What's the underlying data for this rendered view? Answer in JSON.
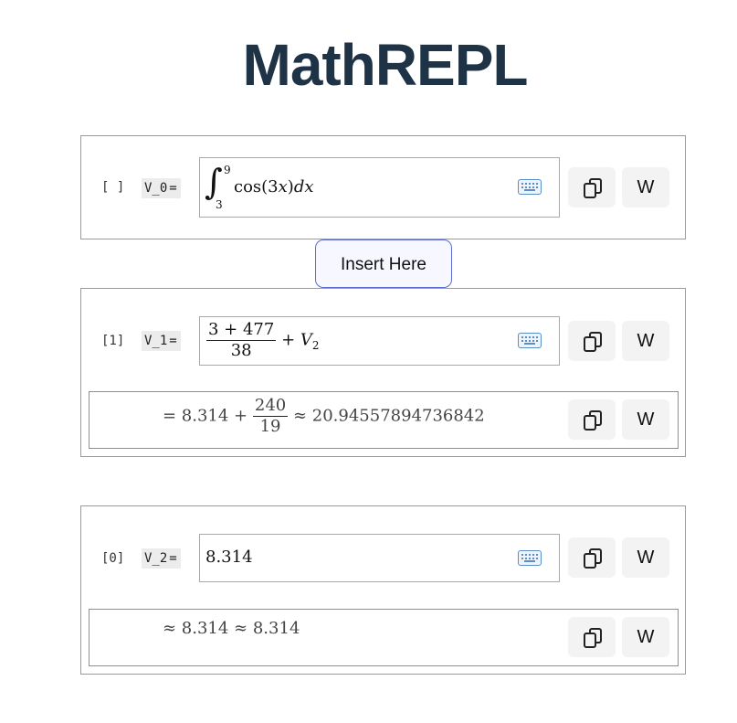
{
  "app": {
    "title": "MathREPL"
  },
  "insert_button": "Insert Here",
  "cells": [
    {
      "exec": "[ ]",
      "var": "V_0",
      "eq": "=",
      "input": {
        "upper": "9",
        "lower": "3",
        "integrand": "cos(3",
        "var_x": "x",
        "close": ")",
        "d": "d",
        "var_x2": "x"
      },
      "copy": "copy",
      "wolfram": "W"
    },
    {
      "exec": "[1]",
      "var": "V_1",
      "eq": "=",
      "input": {
        "num": "3 + 477",
        "den": "38",
        "plus": "+",
        "V": "V",
        "sub": "2"
      },
      "result": {
        "prefix": "= 8.314 +",
        "num": "240",
        "den": "19",
        "approx": "≈ 20.94557894736842"
      },
      "wolfram": "W"
    },
    {
      "exec": "[0]",
      "var": "V_2",
      "eq": "=",
      "input": {
        "value": "8.314"
      },
      "result": {
        "text": "≈ 8.314 ≈ 8.314"
      },
      "wolfram": "W"
    }
  ]
}
